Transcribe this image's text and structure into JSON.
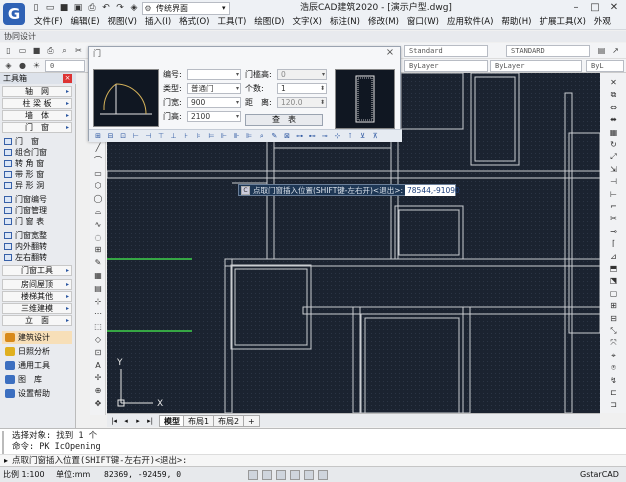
{
  "app": {
    "logo_letter": "G",
    "workspace": "传统界面",
    "title": "浩辰CAD建筑2020 - [演示户型.dwg]",
    "menus": [
      "文件(F)",
      "编辑(E)",
      "视图(V)",
      "插入(I)",
      "格式(O)",
      "工具(T)",
      "绘图(D)",
      "文字(X)",
      "标注(N)",
      "修改(M)",
      "窗口(W)",
      "应用软件(A)",
      "帮助(H)",
      "扩展工具(X)",
      "外观"
    ],
    "collab": "协同设计",
    "style_combo": "Standard",
    "style_combo2": "STANDARD",
    "layer_combo1": "ByLayer",
    "layer_combo2": "ByLayer",
    "layer_combo3": "ByL",
    "layer_text": "0"
  },
  "left_panel": {
    "title": "工具箱",
    "close": "×",
    "categories": [
      {
        "label": "轴　网"
      },
      {
        "label": "柱 梁 板"
      },
      {
        "label": "墙　体"
      },
      {
        "label": "门　窗"
      }
    ],
    "items": [
      "门　窗",
      "组合门窗",
      "转 角 窗",
      "带 形 窗",
      "异 形 洞",
      "门窗编号",
      "门窗管理",
      "门 窗 表",
      "门窗宽整",
      "内外翻转",
      "左右翻转"
    ],
    "tool_cat": "门窗工具",
    "more_cats": [
      "房间屋顶",
      "楼梯其他",
      "三维建模",
      "立　面"
    ],
    "bottom": [
      {
        "label": "建筑设计",
        "color": "#d88a1a"
      },
      {
        "label": "日照分析",
        "color": "#e0b020"
      },
      {
        "label": "通用工具",
        "color": "#3c6fc0"
      },
      {
        "label": "图　库",
        "color": "#3c6fc0"
      },
      {
        "label": "设置帮助",
        "color": "#3c6fc0"
      }
    ]
  },
  "dialog": {
    "title_icon": "门",
    "close": "×",
    "labels": {
      "number": "编号:",
      "type": "类型:",
      "width": "门宽:",
      "height": "门高:",
      "threshold": "门槛高:",
      "count": "个数:",
      "distance": "距　离:"
    },
    "values": {
      "number": "",
      "type": "普通门",
      "width": "900",
      "height": "2100",
      "threshold": "0",
      "count": "1",
      "distance": "120.0"
    },
    "search": "查　表"
  },
  "canvas": {
    "coord_prompt": "点取门窗插入位置(SHIFT键-左右开)<退出>:",
    "coord_value": "78544,-91090",
    "ucs_y": "Y",
    "ucs_x": "X"
  },
  "layout_tabs": {
    "tabs": [
      "模型",
      "布局1",
      "布局2"
    ],
    "active_index": 0,
    "add": "+"
  },
  "command": {
    "lines": [
      "选择对象: 找到 1 个",
      "命令: PK IcOpening",
      "点取门窗插入位置(SHIFT键-左右开)<退出>:"
    ]
  },
  "status": {
    "scale": "比例 1:100",
    "unit": "单位:mm",
    "coords": "82369, -92459, 0",
    "brand": "GstarCAD"
  }
}
